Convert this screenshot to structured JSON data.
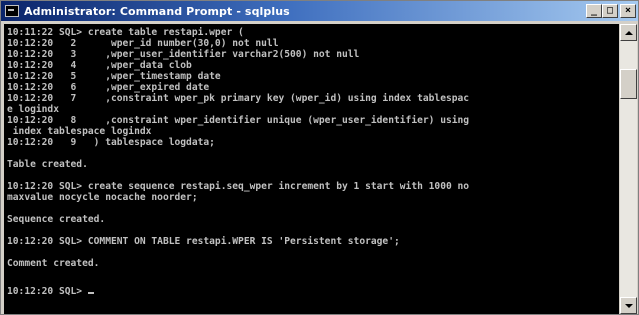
{
  "window": {
    "title": "Administrator: Command Prompt - sqlplus",
    "buttons": {
      "minimize": "_",
      "maximize": "□",
      "close": "×"
    }
  },
  "console": {
    "lines": [
      "10:11:22 SQL> create table restapi.wper (",
      "10:12:20   2      wper_id number(30,0) not null",
      "10:12:20   3     ,wper_user_identifier varchar2(500) not null",
      "10:12:20   4     ,wper_data clob",
      "10:12:20   5     ,wper_timestamp date",
      "10:12:20   6     ,wper_expired date",
      "10:12:20   7     ,constraint wper_pk primary key (wper_id) using index tablespac",
      "e logindx",
      "10:12:20   8     ,constraint wper_identifier unique (wper_user_identifier) using",
      " index tablespace logindx",
      "10:12:20   9   ) tablespace logdata;",
      "",
      "Table created.",
      "",
      "10:12:20 SQL> create sequence restapi.seq_wper increment by 1 start with 1000 no",
      "maxvalue nocycle nocache noorder;",
      "",
      "Sequence created.",
      "",
      "10:12:20 SQL> COMMENT ON TABLE restapi.WPER IS 'Persistent storage';",
      "",
      "Comment created.",
      ""
    ],
    "prompt": "10:12:20 SQL> "
  }
}
